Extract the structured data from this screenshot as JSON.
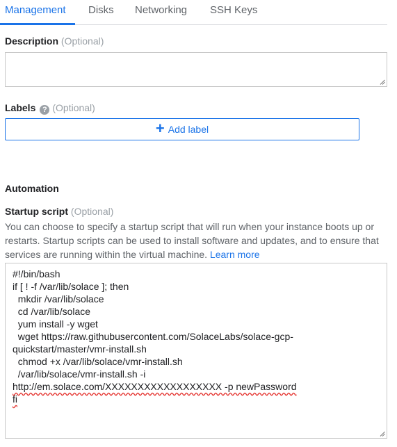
{
  "tabs": [
    {
      "label": "Management",
      "active": true
    },
    {
      "label": "Disks",
      "active": false
    },
    {
      "label": "Networking",
      "active": false
    },
    {
      "label": "SSH Keys",
      "active": false
    }
  ],
  "description": {
    "label": "Description",
    "optional": "(Optional)",
    "value": ""
  },
  "labels": {
    "label": "Labels",
    "optional": "(Optional)",
    "add_button": "Add label",
    "help_icon": "help-circle-icon"
  },
  "automation": {
    "title": "Automation",
    "startup_script": {
      "label": "Startup script",
      "optional": "(Optional)",
      "description": "You can choose to specify a startup script that will run when your instance boots up or restarts. Startup scripts can be used to install software and updates, and to ensure that services are running within the virtual machine.",
      "learn_more": "Learn more",
      "lines": [
        "#!/bin/bash",
        "if [ ! -f /var/lib/solace ]; then",
        "  mkdir /var/lib/solace",
        "  cd /var/lib/solace",
        "  yum install -y wget",
        "  wget https://raw.githubusercontent.com/SolaceLabs/solace-gcp-",
        "quickstart/master/vmr-install.sh",
        "  chmod +x /var/lib/solace/vmr-install.sh",
        "  /var/lib/solace/vmr-install.sh -i",
        "http://em.solace.com/XXXXXXXXXXXXXXXXXX -p newPassword",
        "fi"
      ]
    }
  },
  "colors": {
    "accent": "#1a73e8",
    "muted": "#9aa0a6",
    "text": "#202124",
    "spellcheck": "#e53935"
  }
}
